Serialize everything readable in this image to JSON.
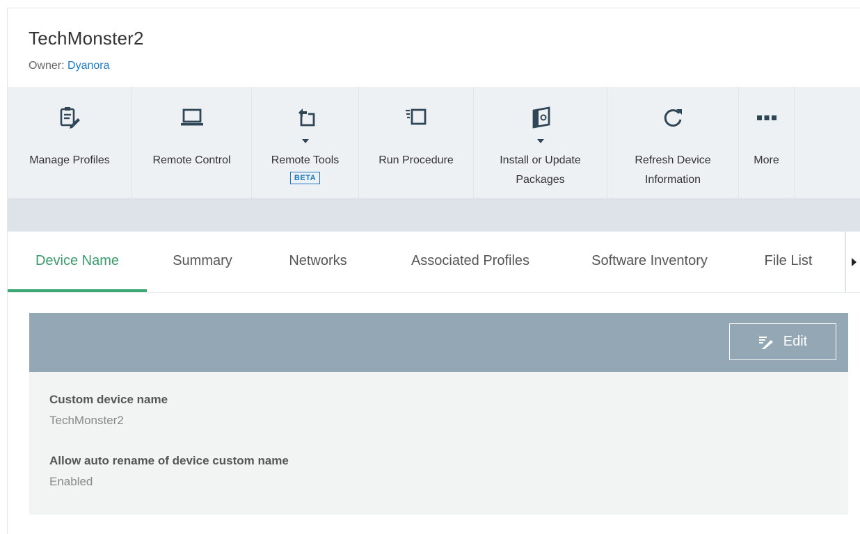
{
  "device": {
    "title": "TechMonster2",
    "owner_prefix": "Owner: ",
    "owner_name": "Dyanora"
  },
  "toolbar": {
    "manage_profiles": "Manage Profiles",
    "remote_control": "Remote Control",
    "remote_tools": "Remote Tools",
    "remote_tools_badge": "BETA",
    "run_procedure": "Run Procedure",
    "install_update_line1": "Install or Update",
    "install_update_line2": "Packages",
    "refresh_line1": "Refresh Device",
    "refresh_line2": "Information",
    "more": "More"
  },
  "tabs": {
    "device_name": "Device Name",
    "summary": "Summary",
    "networks": "Networks",
    "associated_profiles": "Associated Profiles",
    "software_inventory": "Software Inventory",
    "file_list": "File List",
    "active": "Device Name"
  },
  "panel": {
    "edit_label": "Edit",
    "fields": [
      {
        "label": "Custom device name",
        "value": "TechMonster2"
      },
      {
        "label": "Allow auto rename of device custom name",
        "value": "Enabled"
      }
    ]
  },
  "colors": {
    "accent_green": "#3aa872",
    "link_blue": "#1a7bc4",
    "icon_navy": "#2f4657",
    "panel_header": "#93a7b4"
  }
}
